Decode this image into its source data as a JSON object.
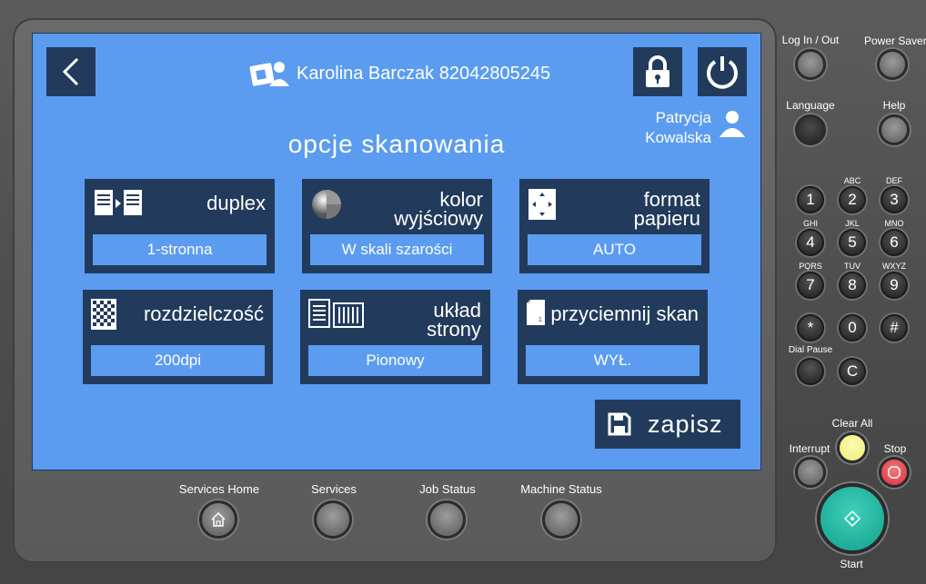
{
  "header": {
    "user_name": "Karolina Barczak 82042805245",
    "operator_first": "Patrycja",
    "operator_last": "Kowalska"
  },
  "page_title": "opcje skanowania",
  "options": [
    {
      "label_1": "duplex",
      "label_2": "",
      "value": "1-stronna"
    },
    {
      "label_1": "kolor",
      "label_2": "wyjściowy",
      "value": "W skali szarości"
    },
    {
      "label_1": "format",
      "label_2": "papieru",
      "value": "AUTO"
    },
    {
      "label_1": "rozdzielczość",
      "label_2": "",
      "value": "200dpi"
    },
    {
      "label_1": "układ",
      "label_2": "strony",
      "value": "Pionowy"
    },
    {
      "label_1": "przyciemnij skan",
      "label_2": "",
      "value": "WYŁ."
    }
  ],
  "save_label": "zapisz",
  "panel": {
    "log_in_out": "Log In / Out",
    "power_saver": "Power Saver",
    "language": "Language",
    "help": "Help",
    "dial_pause": "Dial Pause",
    "clear_all": "Clear All",
    "interrupt": "Interrupt",
    "stop": "Stop",
    "start": "Start",
    "keys": [
      "1",
      "2",
      "3",
      "4",
      "5",
      "6",
      "7",
      "8",
      "9",
      "*",
      "0",
      "#",
      "C"
    ],
    "key_letters": {
      "2": "ABC",
      "3": "DEF",
      "4": "GHI",
      "5": "JKL",
      "6": "MNO",
      "7": "PQRS",
      "8": "TUV",
      "9": "WXYZ"
    }
  },
  "bottom": {
    "services_home": "Services Home",
    "services": "Services",
    "job_status": "Job Status",
    "machine_status": "Machine Status"
  },
  "colors": {
    "screen_bg": "#5b9cf0",
    "tile_bg": "#223b5c",
    "clear_all": "#f3f08a",
    "stop": "#e0454b",
    "start": "#1fae9a"
  }
}
